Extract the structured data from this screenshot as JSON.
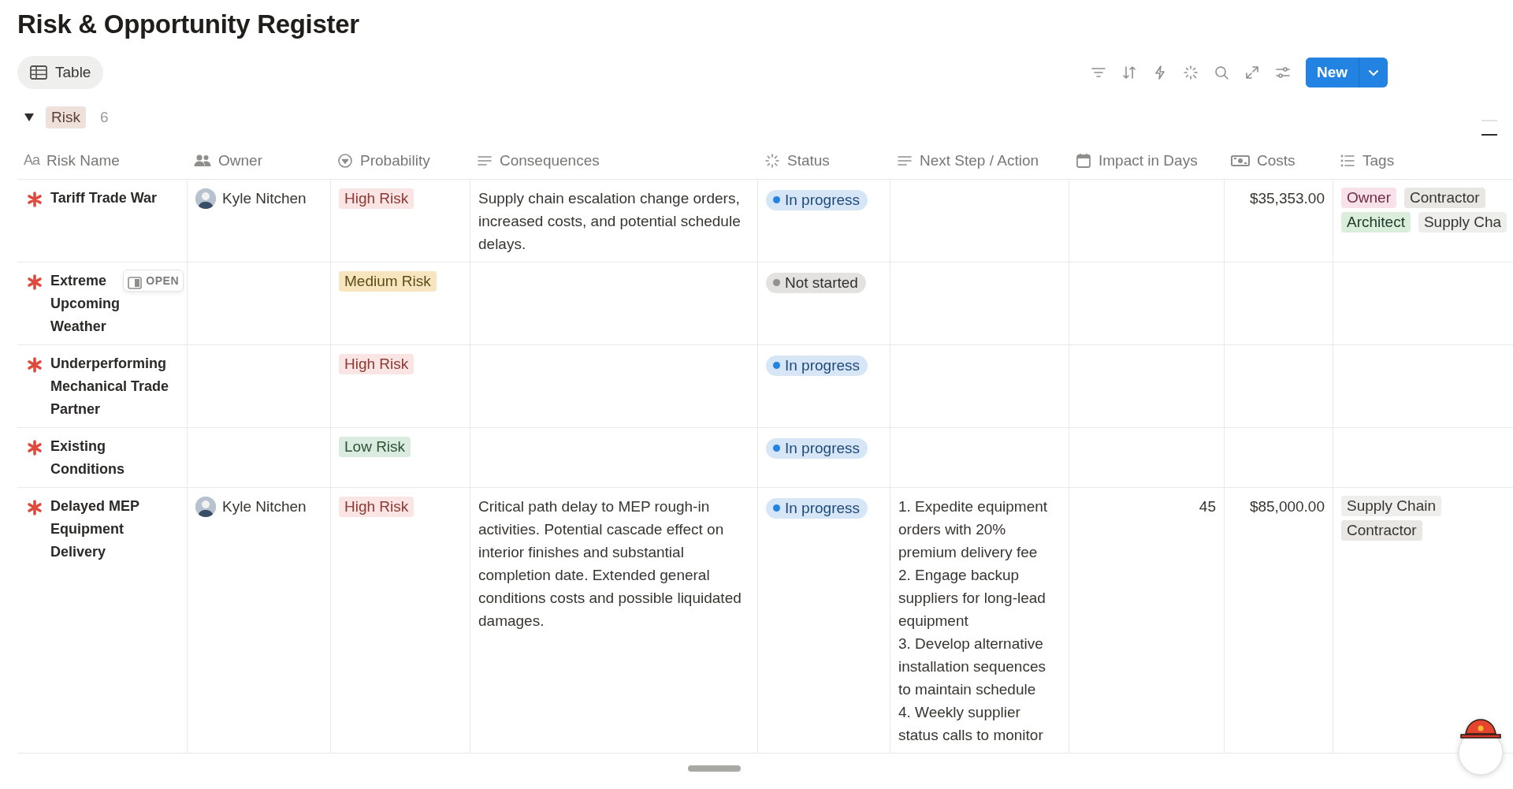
{
  "page": {
    "title": "Risk & Opportunity Register"
  },
  "views": [
    {
      "label": "Table",
      "selected": true
    }
  ],
  "new_button": {
    "label": "New"
  },
  "group": {
    "label": "Risk",
    "count": "6",
    "expanded": true,
    "color": "#eee0da"
  },
  "columns": [
    {
      "label": "Risk Name",
      "kind": "title",
      "icon_text": "Aa"
    },
    {
      "label": "Owner",
      "kind": "person"
    },
    {
      "label": "Probability",
      "kind": "select"
    },
    {
      "label": "Consequences",
      "kind": "text"
    },
    {
      "label": "Status",
      "kind": "status"
    },
    {
      "label": "Next Step / Action",
      "kind": "text"
    },
    {
      "label": "Impact in Days",
      "kind": "date"
    },
    {
      "label": "Costs",
      "kind": "currency"
    },
    {
      "label": "Tags",
      "kind": "multi_select"
    }
  ],
  "rows": [
    {
      "name": "Tariff Trade War",
      "owner": "Kyle Nitchen",
      "probability": {
        "label": "High Risk",
        "color": "#fbe4e4"
      },
      "consequences": "Supply chain escalation change orders, increased costs, and potential schedule delays.",
      "status": {
        "label": "In progress",
        "color": "#2383e2"
      },
      "costs": "$35,353.00",
      "tags": [
        {
          "label": "Owner",
          "color": "#f9e1ea"
        },
        {
          "label": "Contractor",
          "color": "#e8e7e4"
        },
        {
          "label": "Architect",
          "color": "#dbeddb"
        },
        {
          "label": "Supply Cha",
          "color": "#eeeeec"
        }
      ]
    },
    {
      "name": "Extreme Upcoming Weather",
      "open_label": "OPEN",
      "probability": {
        "label": "Medium Risk",
        "color": "#f7e5c0"
      },
      "status": {
        "label": "Not started",
        "color": "#91918e"
      }
    },
    {
      "name": "Underperforming Mechanical Trade Partner",
      "probability": {
        "label": "High Risk",
        "color": "#fbe4e4"
      },
      "status": {
        "label": "In progress",
        "color": "#2383e2"
      }
    },
    {
      "name": "Existing Conditions",
      "probability": {
        "label": "Low Risk",
        "color": "#dcebdf"
      },
      "status": {
        "label": "In progress",
        "color": "#2383e2"
      }
    },
    {
      "name": "Delayed MEP Equipment Delivery",
      "owner": "Kyle Nitchen",
      "probability": {
        "label": "High Risk",
        "color": "#fbe4e4"
      },
      "consequences": "Critical path delay to MEP rough-in activities. Potential cascade effect on interior finishes and substantial completion date. Extended general conditions costs and possible liquidated damages.",
      "status": {
        "label": "In progress",
        "color": "#2383e2"
      },
      "next_steps": [
        "1. Expedite equipment orders with 20% premium delivery fee",
        "2. Engage backup suppliers for long-lead equipment",
        "3. Develop alternative installation sequences to maintain schedule",
        "4. Weekly supplier status calls to monitor"
      ],
      "impact": "45",
      "costs": "$85,000.00",
      "tags": [
        {
          "label": "Supply Chain",
          "color": "#eeeeec"
        },
        {
          "label": "Contractor",
          "color": "#e8e7e4"
        }
      ]
    }
  ]
}
